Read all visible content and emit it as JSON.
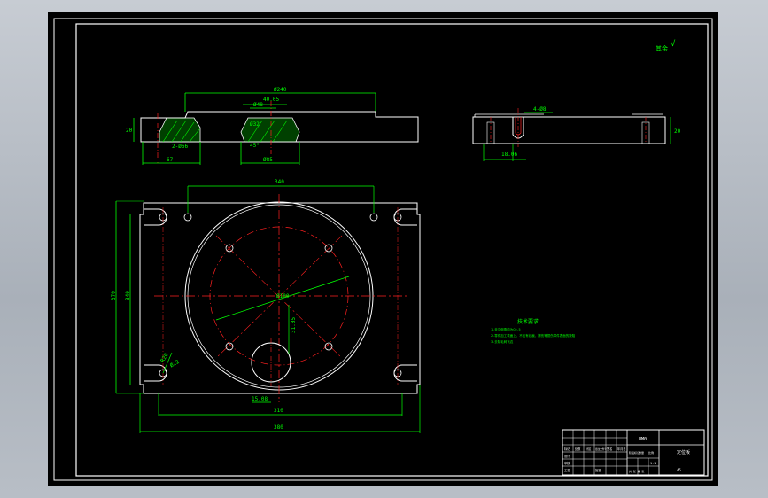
{
  "drawing": {
    "surface_mark": "其余",
    "roughness_symbol": "√",
    "tech_requirements": {
      "title": "技术要求",
      "lines": [
        "1.未注倒角均为C0.5",
        "2.零件加工表面上，不应有划痕、擦伤等损伤零件表面的缺陷",
        "3.去除毛刺飞边"
      ]
    },
    "dimensions": {
      "front_width": "Ø240",
      "front_hole_a": "40.05",
      "front_hole_b": "Ø48",
      "front_hole_c": "Ø32",
      "front_left_h": "20",
      "front_left_x": "67",
      "front_left_dia": "2-Ø66",
      "front_right_dia": "Ø85",
      "front_angle": "45°",
      "side_top": "4-Ø8",
      "side_bottom": "18.06",
      "side_h": "20",
      "plan_top": "340",
      "plan_left_outer": "370",
      "plan_left_inner": "340",
      "plan_bottom_inner": "310",
      "plan_bottom_outer": "380",
      "plan_center": "Ø180",
      "plan_radial": "31.05",
      "plan_small_dia": "15.08",
      "plan_corner_a": "R20",
      "plan_corner_b": "Ø22"
    },
    "title_block": {
      "part_name": "定位板",
      "drawing_no": "WM0",
      "material": "45",
      "scale": "1:1",
      "sheet": "1",
      "row_labels": [
        "标记",
        "处数",
        "分区",
        "更改文件号",
        "签名",
        "年月日"
      ],
      "design_label": "设计",
      "check_label": "审核",
      "process_label": "工艺",
      "approve_label": "批准",
      "stage_label": "阶段标记",
      "weight_label": "重量",
      "scale_label": "比例",
      "sheets_label": "共 张 第 张"
    }
  }
}
